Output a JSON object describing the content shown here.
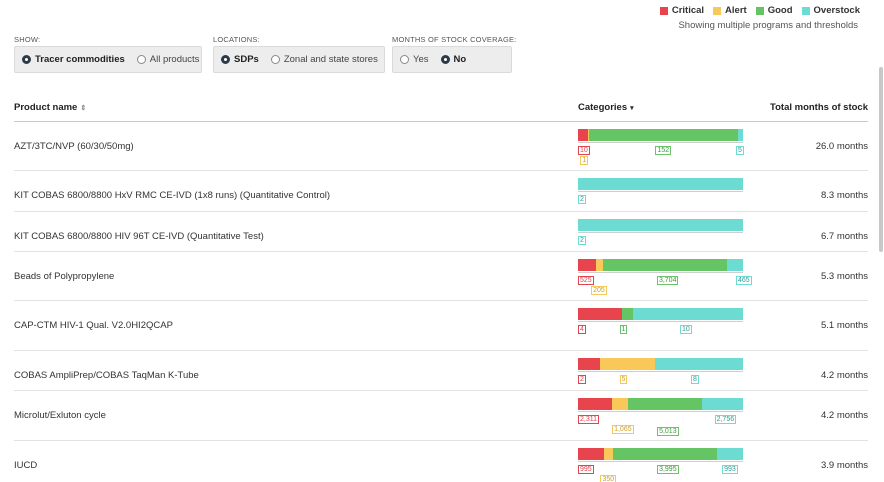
{
  "legend": {
    "items": [
      {
        "label": "Critical",
        "color": "#e8444e"
      },
      {
        "label": "Alert",
        "color": "#f8c959"
      },
      {
        "label": "Good",
        "color": "#65c565"
      },
      {
        "label": "Overstock",
        "color": "#6cdcd3"
      }
    ],
    "subtitle": "Showing multiple programs and thresholds"
  },
  "filters": {
    "show": {
      "label": "SHOW:",
      "options": [
        "Tracer commodities",
        "All products"
      ],
      "selected": 0
    },
    "locations": {
      "label": "LOCATIONS:",
      "options": [
        "SDPs",
        "Zonal and state stores"
      ],
      "selected": 0
    },
    "coverage": {
      "label": "MONTHS OF STOCK COVERAGE:",
      "options": [
        "Yes",
        "No"
      ],
      "selected": 1
    }
  },
  "table": {
    "headers": {
      "name": "Product name",
      "categories": "Categories",
      "total": "Total months of stock"
    },
    "rows": [
      {
        "name": "AZT/3TC/NVP (60/30/50mg)",
        "months": "26.0 months",
        "segments": [
          {
            "cat": "c",
            "value": 10
          },
          {
            "cat": "a",
            "value": 1
          },
          {
            "cat": "g",
            "value": 152
          },
          {
            "cat": "o",
            "value": 5
          }
        ],
        "labels": [
          "10",
          "1",
          "152",
          "5"
        ]
      },
      {
        "name": "KIT COBAS 6800/8800 HxV RMC CE-IVD (1x8 runs) (Quantitative Control)",
        "months": "8.3 months",
        "segments": [
          {
            "cat": "o",
            "value": 2
          }
        ],
        "labels": [
          "2"
        ]
      },
      {
        "name": "KIT COBAS 6800/8800 HIV 96T CE-IVD (Quantitative Test)",
        "months": "6.7 months",
        "segments": [
          {
            "cat": "o",
            "value": 2
          }
        ],
        "labels": [
          "2"
        ]
      },
      {
        "name": "Beads of Polypropylene",
        "months": "5.3 months",
        "segments": [
          {
            "cat": "c",
            "value": 525
          },
          {
            "cat": "a",
            "value": 205
          },
          {
            "cat": "g",
            "value": 3704
          },
          {
            "cat": "o",
            "value": 465
          }
        ],
        "labels": [
          "525",
          "205",
          "3,704",
          "465"
        ]
      },
      {
        "name": "CAP-CTM HIV-1 Qual. V2.0HI2QCAP",
        "months": "5.1 months",
        "segments": [
          {
            "cat": "c",
            "value": 4
          },
          {
            "cat": "g",
            "value": 1
          },
          {
            "cat": "o",
            "value": 10
          }
        ],
        "labels": [
          "4",
          "1",
          "10"
        ]
      },
      {
        "name": "COBAS AmpliPrep/COBAS TaqMan K-Tube",
        "months": "4.2 months",
        "segments": [
          {
            "cat": "c",
            "value": 2
          },
          {
            "cat": "a",
            "value": 5
          },
          {
            "cat": "o",
            "value": 8
          }
        ],
        "labels": [
          "2",
          "5",
          "8"
        ]
      },
      {
        "name": "Microlut/Exluton cycle",
        "months": "4.2 months",
        "segments": [
          {
            "cat": "c",
            "value": 2311
          },
          {
            "cat": "a",
            "value": 1065
          },
          {
            "cat": "g",
            "value": 5013
          },
          {
            "cat": "o",
            "value": 2756
          }
        ],
        "labels": [
          "2,311",
          "1,065",
          "5,013",
          "2,756"
        ]
      },
      {
        "name": "IUCD",
        "months": "3.9 months",
        "segments": [
          {
            "cat": "c",
            "value": 995
          },
          {
            "cat": "a",
            "value": 350
          },
          {
            "cat": "g",
            "value": 3995
          },
          {
            "cat": "o",
            "value": 993
          }
        ],
        "labels": [
          "995",
          "350",
          "3,995",
          "993"
        ]
      }
    ]
  }
}
